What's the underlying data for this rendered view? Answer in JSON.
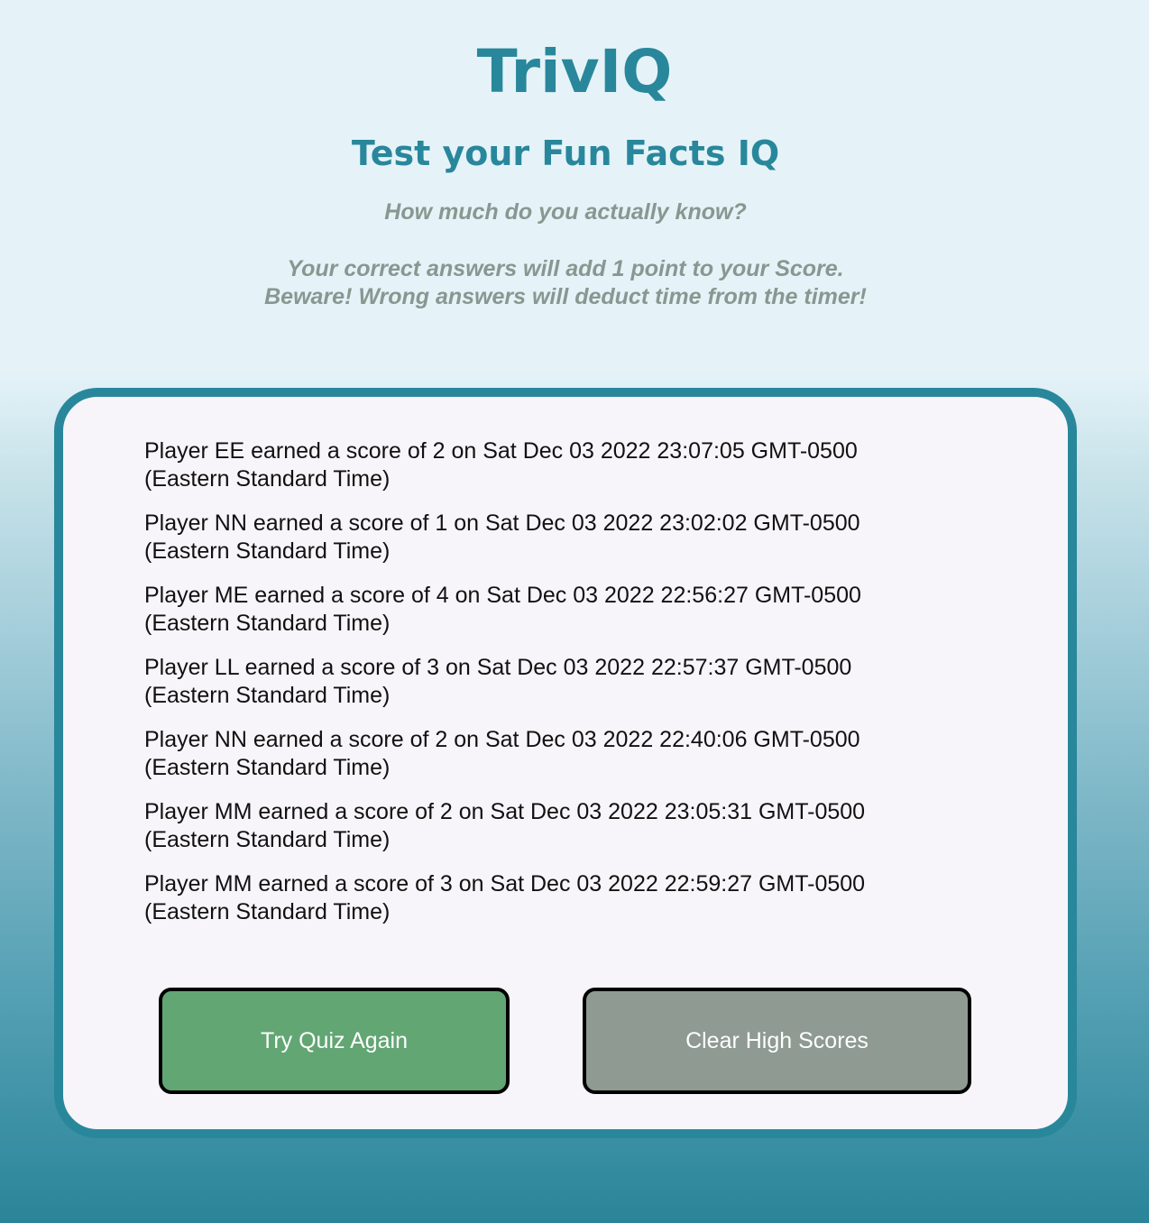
{
  "header": {
    "title": "TrivIQ",
    "subtitle": "Test your Fun Facts IQ",
    "tagline": "How much do you actually know?",
    "rules_line1": "Your correct answers will add 1 point to your Score.",
    "rules_line2": "Beware! Wrong answers will deduct time from the timer!"
  },
  "high_scores": [
    {
      "line1": "Player EE earned a score of 2 on Sat Dec 03 2022 23:07:05 GMT-0500",
      "line2": "(Eastern Standard Time)"
    },
    {
      "line1": "Player NN earned a score of 1 on Sat Dec 03 2022 23:02:02 GMT-0500",
      "line2": "(Eastern Standard Time)"
    },
    {
      "line1": "Player ME earned a score of 4 on Sat Dec 03 2022 22:56:27 GMT-0500",
      "line2": "(Eastern Standard Time)"
    },
    {
      "line1": "Player LL earned a score of 3 on Sat Dec 03 2022 22:57:37 GMT-0500",
      "line2": "(Eastern Standard Time)"
    },
    {
      "line1": "Player NN earned a score of 2 on Sat Dec 03 2022 22:40:06 GMT-0500",
      "line2": "(Eastern Standard Time)"
    },
    {
      "line1": "Player MM earned a score of 2 on Sat Dec 03 2022 23:05:31 GMT-0500",
      "line2": "(Eastern Standard Time)"
    },
    {
      "line1": "Player MM earned a score of 3 on Sat Dec 03 2022 22:59:27 GMT-0500",
      "line2": "(Eastern Standard Time)"
    }
  ],
  "buttons": {
    "retry_label": "Try Quiz Again",
    "clear_label": "Clear High Scores"
  },
  "colors": {
    "accent": "#29879b",
    "retry_button": "#62a673",
    "clear_button": "#8e9a92",
    "tagline": "#8a9690"
  }
}
